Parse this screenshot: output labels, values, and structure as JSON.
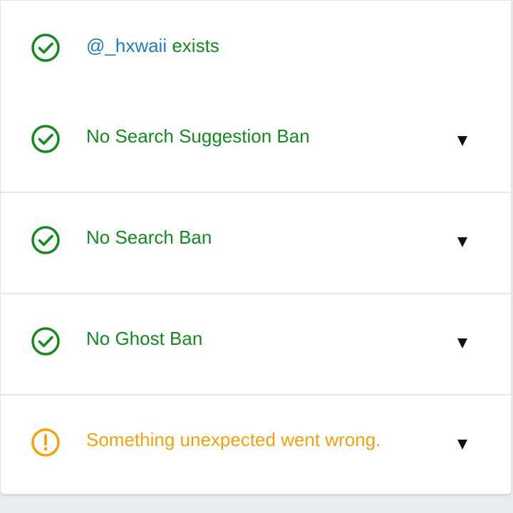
{
  "colors": {
    "ok": "#148a1f",
    "warn": "#f2a20c",
    "link": "#1c7ec4",
    "caret": "#111111",
    "divider": "#e3e8ec",
    "background": "#e9edf0"
  },
  "results": [
    {
      "icon": "check-circle-icon",
      "status": "ok",
      "username": "@_hxwaii",
      "suffix": " exists",
      "expandable": false
    },
    {
      "icon": "check-circle-icon",
      "status": "ok",
      "label": "No Search Suggestion Ban",
      "expandable": true
    },
    {
      "icon": "check-circle-icon",
      "status": "ok",
      "label": "No Search Ban",
      "expandable": true
    },
    {
      "icon": "check-circle-icon",
      "status": "ok",
      "label": "No Ghost Ban",
      "expandable": true
    },
    {
      "icon": "exclamation-circle-icon",
      "status": "warn",
      "label": "Something unexpected went wrong.",
      "expandable": true
    }
  ]
}
